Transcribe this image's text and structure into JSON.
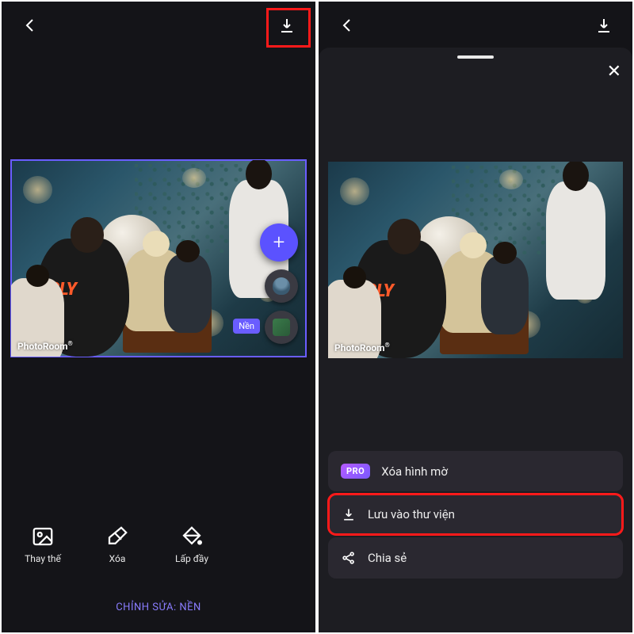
{
  "left": {
    "watermark": "PhotoRoom",
    "layer_label": "Nền",
    "tools": {
      "replace": "Thay thế",
      "delete": "Xóa",
      "fill": "Lấp đầy"
    },
    "footer": "CHỈNH SỬA: NỀN"
  },
  "right": {
    "watermark": "PhotoRoom",
    "pro": "PRO",
    "menu": {
      "remove_watermark": "Xóa hình mờ",
      "save_library": "Lưu vào thư viện",
      "share": "Chia sẻ"
    }
  }
}
